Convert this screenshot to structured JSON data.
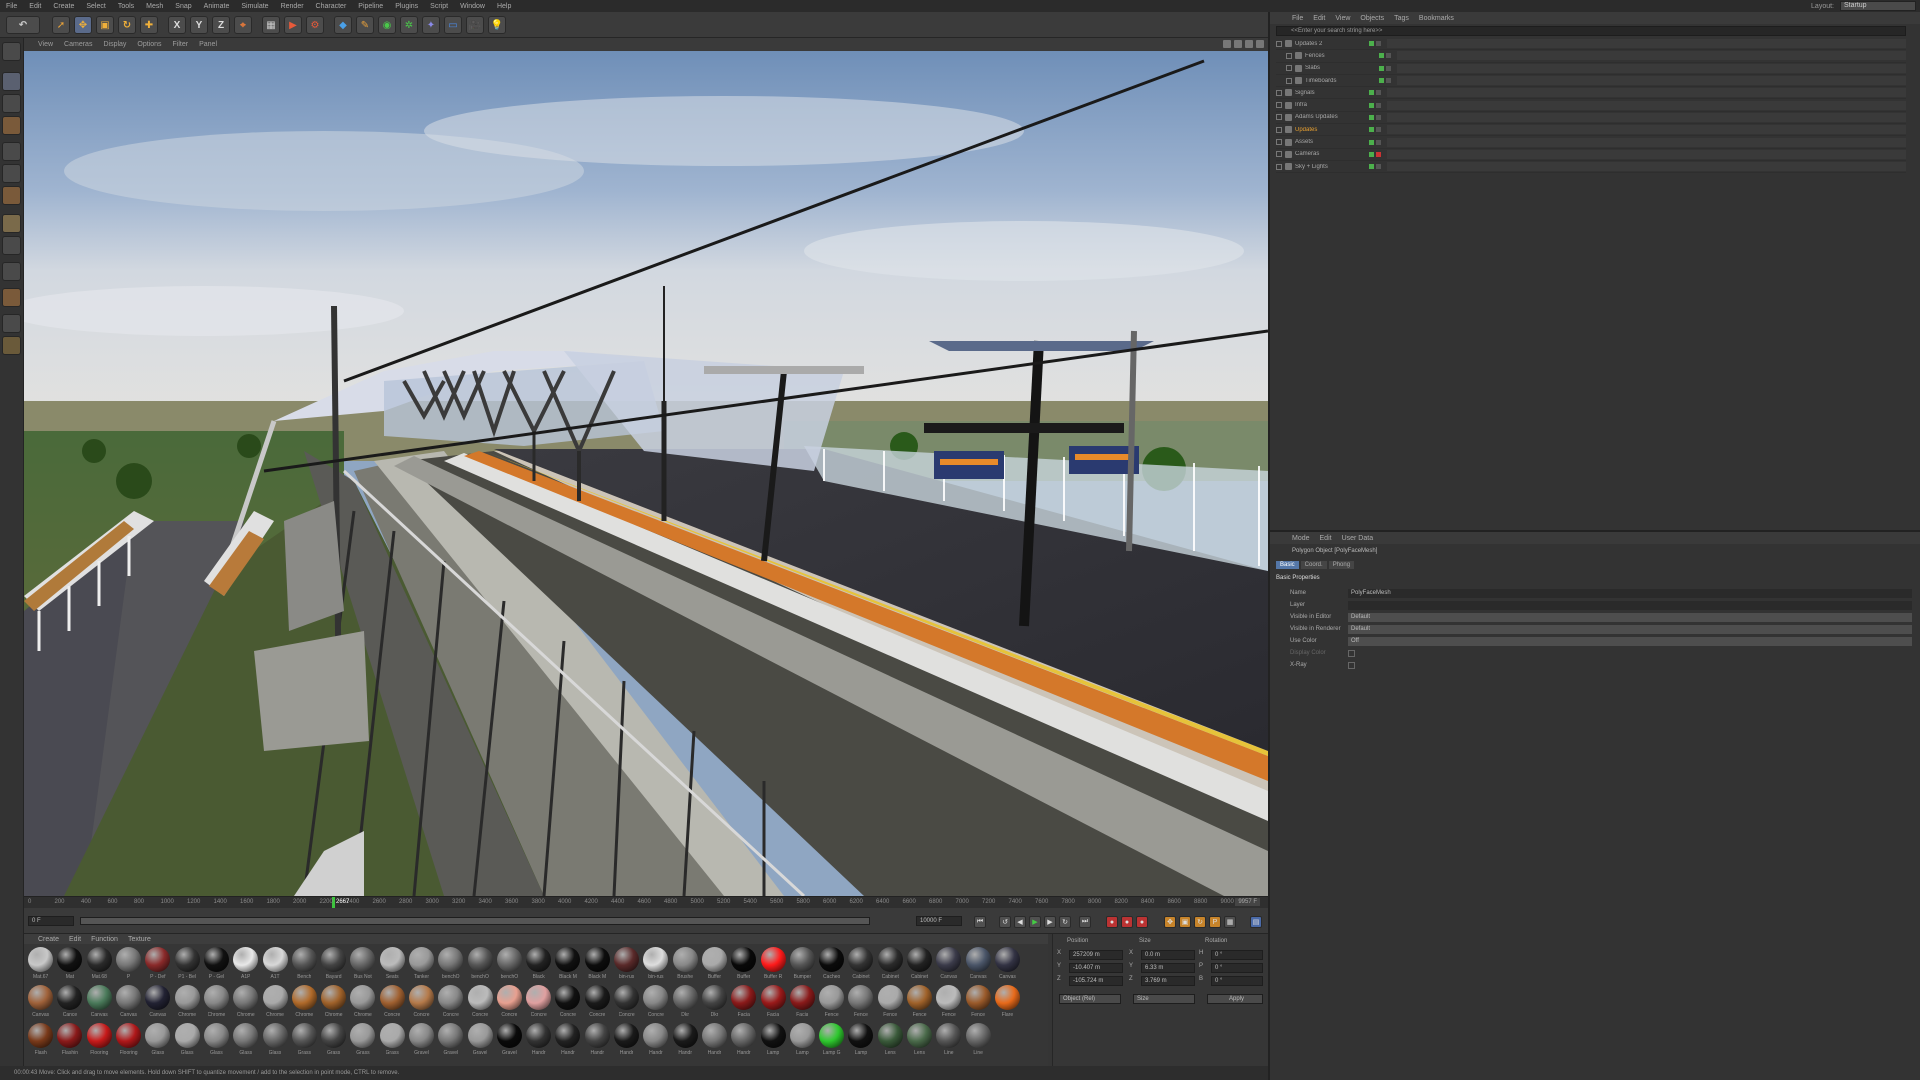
{
  "menu": [
    "File",
    "Edit",
    "Create",
    "Select",
    "Tools",
    "Mesh",
    "Snap",
    "Animate",
    "Simulate",
    "Render",
    "Character",
    "Pipeline",
    "Plugins",
    "Script",
    "Window",
    "Help"
  ],
  "layout": {
    "label": "Layout:",
    "value": "Startup"
  },
  "toolbar_axis": {
    "x": "X",
    "y": "Y",
    "z": "Z"
  },
  "viewport_menu": [
    "View",
    "Cameras",
    "Display",
    "Options",
    "Filter",
    "Panel"
  ],
  "timeline": {
    "ticks": [
      "0",
      "200",
      "400",
      "600",
      "800",
      "1000",
      "1200",
      "1400",
      "1600",
      "1800",
      "2000",
      "2200",
      "2400",
      "2600",
      "2800",
      "3000",
      "3200",
      "3400",
      "3600",
      "3800",
      "4000",
      "4200",
      "4400",
      "4600",
      "4800",
      "5000",
      "5200",
      "5400",
      "5600",
      "5800",
      "6000",
      "6200",
      "6400",
      "6600",
      "6800",
      "7000",
      "7200",
      "7400",
      "7600",
      "7800",
      "8000",
      "8200",
      "8400",
      "8600",
      "8800",
      "9000"
    ],
    "current": "2667",
    "end": "9957 F"
  },
  "transport": {
    "start_field": "0 F",
    "end_field": "10000 F"
  },
  "material_menu": [
    "Create",
    "Edit",
    "Function",
    "Texture"
  ],
  "materials": [
    {
      "n": "Mat.67",
      "c": "#c8c8c8"
    },
    {
      "n": "Mat",
      "c": "#111"
    },
    {
      "n": "Mat.68",
      "c": "#2a2a2a"
    },
    {
      "n": "P",
      "c": "#777"
    },
    {
      "n": "P - Def",
      "c": "#8a2a2a"
    },
    {
      "n": "P1 - Bel",
      "c": "#333"
    },
    {
      "n": "P - Gel",
      "c": "#111"
    },
    {
      "n": "A1P",
      "c": "#e8e8e8"
    },
    {
      "n": "A1T",
      "c": "#d8d8d8"
    },
    {
      "n": "Bench",
      "c": "#555"
    },
    {
      "n": "Bayard",
      "c": "#444"
    },
    {
      "n": "Bus Not",
      "c": "#666"
    },
    {
      "n": "Seats",
      "c": "#bbb"
    },
    {
      "n": "Tanker",
      "c": "#999"
    },
    {
      "n": "benchO",
      "c": "#777"
    },
    {
      "n": "benchO",
      "c": "#555"
    },
    {
      "n": "benchO",
      "c": "#666"
    },
    {
      "n": "Black",
      "c": "#222"
    },
    {
      "n": "Black M",
      "c": "#111"
    },
    {
      "n": "Black M",
      "c": "#0d0d0d"
    },
    {
      "n": "bin-rus",
      "c": "#5a2a2a"
    },
    {
      "n": "bin-rus",
      "c": "#ddd"
    },
    {
      "n": "Brushe",
      "c": "#888"
    },
    {
      "n": "Buffer",
      "c": "#aaa"
    },
    {
      "n": "Buffer",
      "c": "#090909"
    },
    {
      "n": "Buffer R",
      "c": "#ff1a1a"
    },
    {
      "n": "Bumper",
      "c": "#555"
    },
    {
      "n": "Cacheo",
      "c": "#0b0b0b"
    },
    {
      "n": "Cabinet",
      "c": "#333"
    },
    {
      "n": "Cabinet",
      "c": "#2b2b2b"
    },
    {
      "n": "Cabinet",
      "c": "#222"
    },
    {
      "n": "Canvas",
      "c": "#3b3b4a"
    },
    {
      "n": "Canvas",
      "c": "#4a5568"
    },
    {
      "n": "Canvas",
      "c": "#334"
    },
    {
      "n": "Canvas",
      "c": "#a0623a"
    },
    {
      "n": "Cance",
      "c": "#222"
    },
    {
      "n": "Canvas",
      "c": "#4a7a5a"
    },
    {
      "n": "Canvas",
      "c": "#777"
    },
    {
      "n": "Canvas",
      "c": "#223"
    },
    {
      "n": "Chrome",
      "c": "#999"
    },
    {
      "n": "Chrome",
      "c": "#888"
    },
    {
      "n": "Chrome",
      "c": "#777"
    },
    {
      "n": "Chrome",
      "c": "#aaa"
    },
    {
      "n": "Chrome",
      "c": "#b06a2a"
    },
    {
      "n": "Chrome",
      "c": "#a0622a"
    },
    {
      "n": "Chrome",
      "c": "#999"
    },
    {
      "n": "Concre",
      "c": "#a06030"
    },
    {
      "n": "Concre",
      "c": "#b57a4a"
    },
    {
      "n": "Concre",
      "c": "#888"
    },
    {
      "n": "Concre",
      "c": "#bbb"
    },
    {
      "n": "Concre",
      "c": "#e8a090"
    },
    {
      "n": "Concre",
      "c": "#e0a0a0"
    },
    {
      "n": "Concre",
      "c": "#111"
    },
    {
      "n": "Concre",
      "c": "#1a1a1a"
    },
    {
      "n": "Concre",
      "c": "#333"
    },
    {
      "n": "Concre",
      "c": "#888"
    },
    {
      "n": "Dkr",
      "c": "#666"
    },
    {
      "n": "Dkr",
      "c": "#444"
    },
    {
      "n": "Facia",
      "c": "#8b1a1a"
    },
    {
      "n": "Facia",
      "c": "#9a1a1a"
    },
    {
      "n": "Facia",
      "c": "#8a1a1a"
    },
    {
      "n": "Fence",
      "c": "#999"
    },
    {
      "n": "Fence",
      "c": "#777"
    },
    {
      "n": "Fence",
      "c": "#aaa"
    },
    {
      "n": "Fence",
      "c": "#a0622a"
    },
    {
      "n": "Fence",
      "c": "#bbb"
    },
    {
      "n": "Fence",
      "c": "#9a5a2a"
    },
    {
      "n": "Flare",
      "c": "#e86a1a"
    },
    {
      "n": "Flash",
      "c": "#7a3a1a"
    },
    {
      "n": "Flashin",
      "c": "#8b1a1a"
    },
    {
      "n": "Flooring",
      "c": "#c81a1a"
    },
    {
      "n": "Flooring",
      "c": "#b0181a"
    },
    {
      "n": "Glass",
      "c": "#999"
    },
    {
      "n": "Glass",
      "c": "#aaa"
    },
    {
      "n": "Glass",
      "c": "#888"
    },
    {
      "n": "Glass",
      "c": "#777"
    },
    {
      "n": "Glass",
      "c": "#666"
    },
    {
      "n": "Grass",
      "c": "#555"
    },
    {
      "n": "Grass",
      "c": "#444"
    },
    {
      "n": "Grass",
      "c": "#999"
    },
    {
      "n": "Grass",
      "c": "#aaa"
    },
    {
      "n": "Gravel",
      "c": "#888"
    },
    {
      "n": "Gravel",
      "c": "#777"
    },
    {
      "n": "Gravel",
      "c": "#999"
    },
    {
      "n": "Gravel",
      "c": "#0a0a0a"
    },
    {
      "n": "Handr",
      "c": "#333"
    },
    {
      "n": "Handr",
      "c": "#222"
    },
    {
      "n": "Handr",
      "c": "#444"
    },
    {
      "n": "Handr",
      "c": "#1a1a1a"
    },
    {
      "n": "Handr",
      "c": "#888"
    },
    {
      "n": "Handr",
      "c": "#1a1a1a"
    },
    {
      "n": "Handr",
      "c": "#777"
    },
    {
      "n": "Handr",
      "c": "#666"
    },
    {
      "n": "Lamp",
      "c": "#111"
    },
    {
      "n": "Lamp",
      "c": "#999"
    },
    {
      "n": "Lamp G",
      "c": "#2ec82e"
    },
    {
      "n": "Lamp",
      "c": "#111"
    },
    {
      "n": "Lens",
      "c": "#3a5a3a"
    },
    {
      "n": "Lens",
      "c": "#4a6a4a"
    },
    {
      "n": "Line",
      "c": "#555"
    },
    {
      "n": "Line",
      "c": "#666"
    }
  ],
  "coords": {
    "headers": [
      "Position",
      "Size",
      "Rotation"
    ],
    "rows": [
      [
        "X",
        "257209 m",
        "X",
        "0.0 m",
        "H",
        "0 °"
      ],
      [
        "Y",
        "-10.407 m",
        "Y",
        "6.33 m",
        "P",
        "0 °"
      ],
      [
        "Z",
        "-105.724 m",
        "Z",
        "3.769 m",
        "B",
        "0 °"
      ]
    ],
    "mode": "Object (Rel)",
    "size_mode": "Size",
    "apply": "Apply"
  },
  "status": "00:00:43  Move: Click and drag to move elements. Hold down SHIFT to quantize movement / add to the selection in point mode, CTRL to remove.",
  "object_manager": {
    "menu": [
      "File",
      "Edit",
      "View",
      "Objects",
      "Tags",
      "Bookmarks"
    ],
    "search_placeholder": "<<Enter your search string here>>",
    "objects": [
      "Updates 2",
      "Fences",
      "Slabs",
      "Timeboards",
      "Signals",
      "Infra",
      "Adams Updates",
      "Updates",
      "Assets",
      "Cameras",
      "Sky + Lights"
    ]
  },
  "attr_manager": {
    "menu": [
      "Mode",
      "Edit",
      "User Data"
    ],
    "object_title": "Polygon Object [PolyFaceMesh]",
    "tabs": [
      "Basic",
      "Coord.",
      "Phong"
    ],
    "section": "Basic Properties",
    "props": [
      {
        "label": "Name",
        "value": "PolyFaceMesh",
        "dd": false
      },
      {
        "label": "Layer",
        "value": "",
        "dd": false
      },
      {
        "label": "Visible in Editor",
        "value": "Default",
        "dd": true
      },
      {
        "label": "Visible in Renderer",
        "value": "Default",
        "dd": true
      },
      {
        "label": "Use Color",
        "value": "Off",
        "dd": true
      },
      {
        "label": "Display Color",
        "value": "",
        "dd": false
      },
      {
        "label": "X-Ray",
        "value": "",
        "dd": false
      }
    ]
  }
}
